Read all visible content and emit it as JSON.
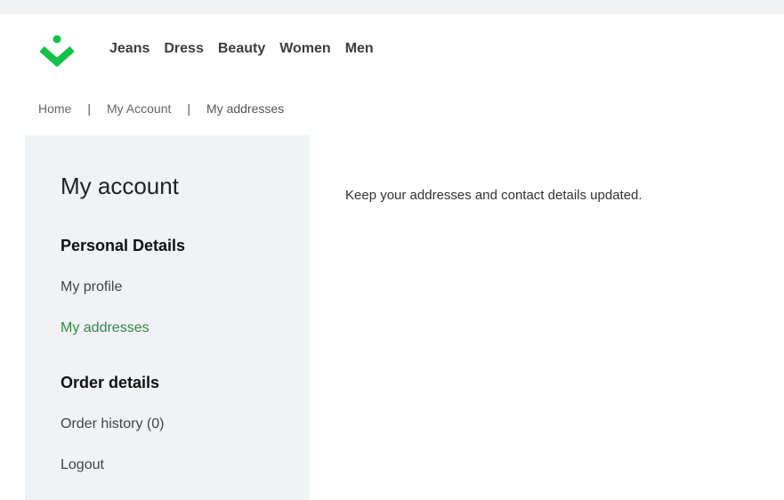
{
  "brand": {
    "logo_icon": "chevron-down-dot-logo",
    "accent_color": "#12c248"
  },
  "nav": {
    "items": [
      {
        "label": "Jeans"
      },
      {
        "label": "Dress"
      },
      {
        "label": "Beauty"
      },
      {
        "label": "Women"
      },
      {
        "label": "Men"
      }
    ]
  },
  "breadcrumb": {
    "items": [
      {
        "label": "Home"
      },
      {
        "label": "My Account"
      },
      {
        "label": "My addresses"
      }
    ],
    "separator": "|"
  },
  "sidebar": {
    "title": "My account",
    "personal_heading": "Personal Details",
    "personal_links": [
      {
        "label": "My profile"
      },
      {
        "label": "My addresses",
        "active": true
      }
    ],
    "order_heading": "Order details",
    "order_links": [
      {
        "label": "Order history (0)"
      },
      {
        "label": "Logout"
      }
    ],
    "active_color": "#2e8b4a"
  },
  "main": {
    "description": "Keep your addresses and contact details updated."
  }
}
